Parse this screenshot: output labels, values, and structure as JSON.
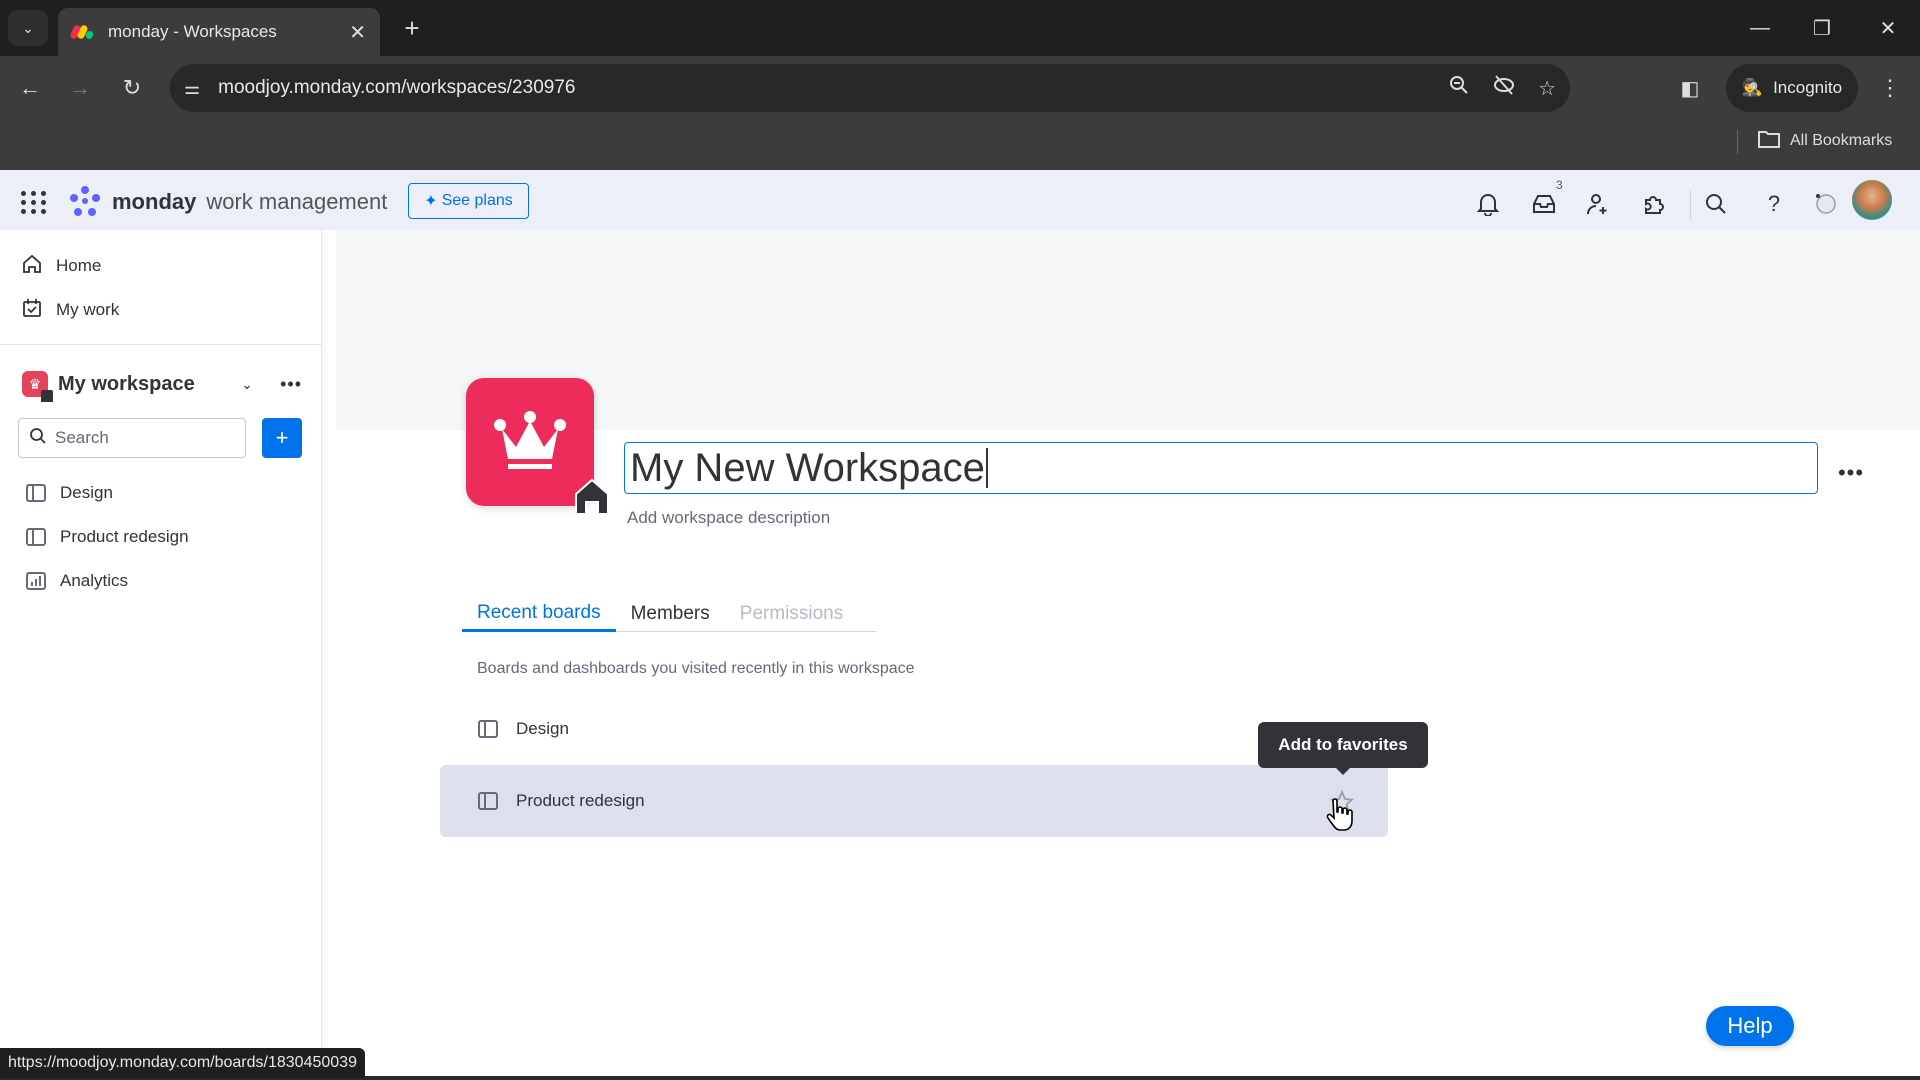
{
  "browser": {
    "tab_title": "monday - Workspaces",
    "url": "moodjoy.monday.com/workspaces/230976",
    "incognito_label": "Incognito",
    "bookmarks_label": "All Bookmarks",
    "status_url": "https://moodjoy.monday.com/boards/1830450039",
    "icons": [
      "tab-search-icon",
      "close-icon",
      "plus-icon",
      "minimize-icon",
      "restore-icon",
      "window-close-icon",
      "back-icon",
      "forward-icon",
      "reload-icon",
      "site-settings-icon",
      "zoom-icon",
      "eye-off-icon",
      "bookmark-star-icon",
      "side-panel-icon",
      "incognito-icon",
      "kebab-menu-icon",
      "folder-icon"
    ]
  },
  "header": {
    "brand": "monday",
    "product": "work management",
    "see_plans_label": "See plans",
    "inbox_badge": "3",
    "icons": [
      "apps-grid-icon",
      "bell-icon",
      "inbox-icon",
      "invite-member-icon",
      "puzzle-icon",
      "search-icon",
      "help-icon",
      "ai-icon",
      "avatar"
    ]
  },
  "sidebar": {
    "nav": [
      {
        "label": "Home",
        "icon": "home-icon"
      },
      {
        "label": "My work",
        "icon": "calendar-check-icon"
      }
    ],
    "workspace_name": "My workspace",
    "search_placeholder": "Search",
    "items": [
      {
        "label": "Design",
        "icon": "board-icon"
      },
      {
        "label": "Product redesign",
        "icon": "board-icon"
      },
      {
        "label": "Analytics",
        "icon": "dashboard-icon"
      }
    ]
  },
  "main": {
    "workspace_title": "My New Workspace",
    "description_placeholder": "Add workspace description",
    "tabs": [
      {
        "label": "Recent boards",
        "state": "active"
      },
      {
        "label": "Members",
        "state": "normal"
      },
      {
        "label": "Permissions",
        "state": "disabled"
      }
    ],
    "tab_description": "Boards and dashboards you visited recently in this workspace",
    "boards": [
      {
        "label": "Design",
        "hovered": false
      },
      {
        "label": "Product redesign",
        "hovered": true
      }
    ],
    "tooltip": "Add to favorites",
    "help_label": "Help"
  },
  "colors": {
    "accent": "#0073ea",
    "workspace_icon": "#ee2c5c",
    "text": "#323338",
    "muted": "#676879"
  }
}
